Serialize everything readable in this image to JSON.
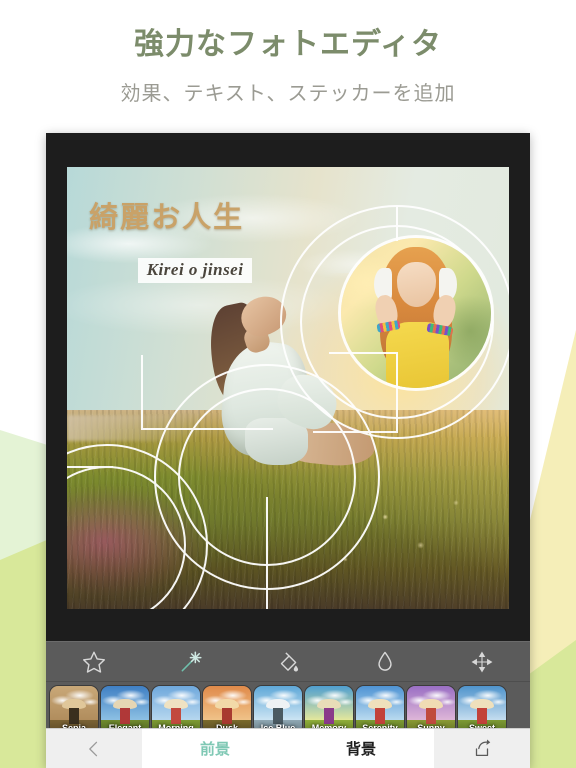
{
  "promo": {
    "headline": "強力なフォトエディタ",
    "subhead": "効果、テキスト、ステッカーを追加"
  },
  "colors": {
    "headline": "#7c8c6b",
    "subhead": "#9b9b93",
    "accent_teal": "#7fc8b4",
    "bg_white": "#ffffff",
    "bg_mint": "#e4f3d5",
    "bg_lime": "#d8e89a",
    "bg_cream": "#f5eeb8",
    "device_frame": "#1d1d1d",
    "toolbar": "#5b5b5b",
    "title_gold": "#c9a268"
  },
  "photo": {
    "title_ja": "綺麗お人生",
    "title_romaji": "Kirei o jinsei",
    "scene": "woman-in-meadow-at-sunset",
    "sticker": "circular-photo-woman-with-headphones"
  },
  "toolbar": {
    "items": [
      {
        "name": "star-icon",
        "label": "Sticker",
        "active": false
      },
      {
        "name": "magic-wand-icon",
        "label": "Effects",
        "active": true
      },
      {
        "name": "paint-bucket-icon",
        "label": "Fill",
        "active": false
      },
      {
        "name": "droplet-icon",
        "label": "Blur",
        "active": false
      },
      {
        "name": "move-arrows-icon",
        "label": "Transform",
        "active": false
      }
    ]
  },
  "filters": [
    {
      "label": "Sepia",
      "sky": "linear-gradient(180deg,#c9a878,#b08c5c)",
      "grass": "linear-gradient(180deg,#7a6234,#5c4a28)",
      "cap": "#e0c79a",
      "stem": "#3a2f1e"
    },
    {
      "label": "Elegant",
      "sky": "linear-gradient(180deg,#3f7fc4,#8fc2e4)",
      "grass": "linear-gradient(180deg,#6f8a2e,#4e6220)",
      "cap": "#e6d6b4",
      "stem": "#b03838"
    },
    {
      "label": "Morning",
      "sky": "linear-gradient(180deg,#6fa8dc,#b8d8ef)",
      "grass": "linear-gradient(180deg,#7d9a34,#566f22)",
      "cap": "#efe2c2",
      "stem": "#c24a3e"
    },
    {
      "label": "Dusk",
      "sky": "linear-gradient(180deg,#e08a4a,#f0c48a)",
      "grass": "linear-gradient(180deg,#7a6a2c,#544722)",
      "cap": "#f2d9a8",
      "stem": "#a83a30"
    },
    {
      "label": "Ice Blue",
      "sky": "linear-gradient(180deg,#5fa8d8,#cfe6f4)",
      "grass": "linear-gradient(180deg,#8fa8b4,#63757e)",
      "cap": "#eef2f4",
      "stem": "#4a5a62"
    },
    {
      "label": "Memory",
      "sky": "linear-gradient(180deg,#4f9fd0,#e8ea9a)",
      "grass": "linear-gradient(180deg,#8fae3a,#637a26)",
      "cap": "#e8dcb8",
      "stem": "#8a3a8a"
    },
    {
      "label": "Serenity",
      "sky": "linear-gradient(180deg,#4f94d4,#bcdcf0)",
      "grass": "linear-gradient(180deg,#7d9a34,#566f22)",
      "cap": "#efe0bc",
      "stem": "#c2423a"
    },
    {
      "label": "Sunny",
      "sky": "linear-gradient(180deg,#9a6fc4,#e0b8d8)",
      "grass": "linear-gradient(180deg,#8a9a34,#5e6c22)",
      "cap": "#f0dcb4",
      "stem": "#c04a3e"
    },
    {
      "label": "Sweet",
      "sky": "linear-gradient(180deg,#4f94cc,#c8dff0)",
      "grass": "linear-gradient(180deg,#7d9a34,#566f22)",
      "cap": "#efe0bc",
      "stem": "#c2423a"
    }
  ],
  "bottom_bar": {
    "back_icon": "chevron-left-icon",
    "tabs": [
      {
        "label": "前景",
        "active": true
      },
      {
        "label": "背景",
        "active": false
      }
    ],
    "share_icon": "share-icon"
  }
}
